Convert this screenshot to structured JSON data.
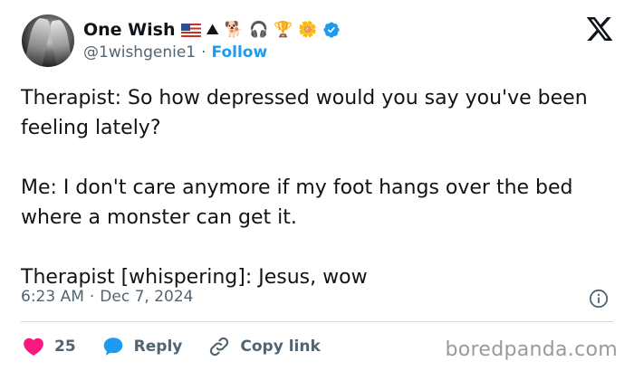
{
  "author": {
    "display_name": "One Wish",
    "handle": "@1wishgenie1",
    "follow_label": "Follow",
    "emojis": [
      "us-flag",
      "⛰",
      "🐕",
      "🎧",
      "🏆",
      "🌼"
    ],
    "verified": true
  },
  "tweet": {
    "paragraphs": [
      "Therapist: So how depressed would you say you've been feeling lately?",
      "Me: I don't care anymore if my foot hangs over the bed where a monster can get it.",
      "Therapist [whispering]: Jesus, wow"
    ],
    "time": "6:23 AM",
    "date": "Dec 7, 2024"
  },
  "actions": {
    "likes": "25",
    "reply_label": "Reply",
    "copy_link_label": "Copy link"
  },
  "watermark": "boredpanda.com",
  "colors": {
    "accent": "#1d9bf0",
    "like": "#f91880",
    "text": "#0f1419",
    "muted": "#536471"
  }
}
